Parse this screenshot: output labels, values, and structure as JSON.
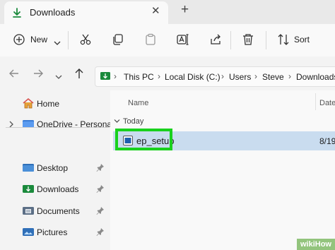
{
  "tab": {
    "title": "Downloads",
    "close": "✕",
    "new_tab": "+"
  },
  "toolbar": {
    "new_label": "New",
    "sort_label": "Sort"
  },
  "breadcrumbs": [
    "This PC",
    "Local Disk (C:)",
    "Users",
    "Steve",
    "Downloads"
  ],
  "sidebar": {
    "home": "Home",
    "onedrive": "OneDrive - Persona",
    "items": [
      {
        "label": "Desktop"
      },
      {
        "label": "Downloads"
      },
      {
        "label": "Documents"
      },
      {
        "label": "Pictures"
      }
    ]
  },
  "content": {
    "col_name": "Name",
    "col_date": "Date",
    "group": "Today",
    "files": [
      {
        "name": "ep_setup",
        "date": "8/19"
      }
    ]
  },
  "watermark": "wikiHow",
  "colors": {
    "highlight": "#19d11d",
    "selected_row": "#c9dcef",
    "accent_green": "#1a8a3c",
    "folder_blue": "#3a7bd5"
  }
}
